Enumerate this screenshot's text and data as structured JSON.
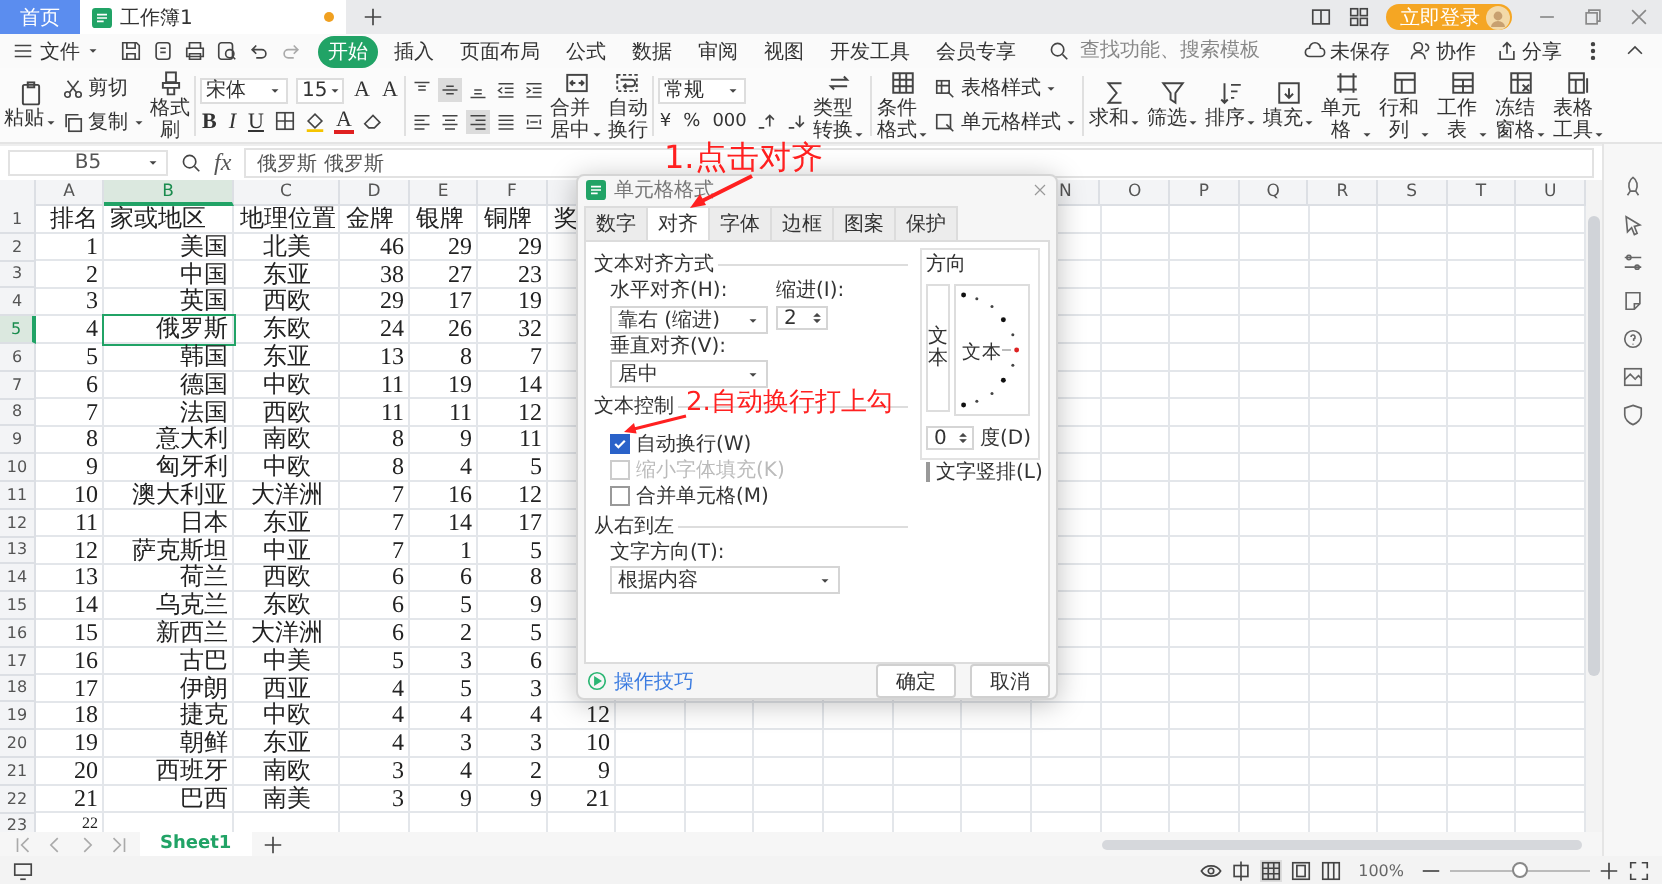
{
  "title_bar": {
    "tabs": [
      {
        "kind": "home",
        "label": "首页",
        "selected": false
      },
      {
        "kind": "doc",
        "label": "工作簿1",
        "selected": true,
        "modified": true
      }
    ],
    "login": "立即登录"
  },
  "menu_bar": {
    "file": "文件",
    "tabs": [
      {
        "label": "开始",
        "selected": true
      },
      {
        "label": "插入",
        "selected": false
      },
      {
        "label": "页面布局",
        "selected": false
      },
      {
        "label": "公式",
        "selected": false
      },
      {
        "label": "数据",
        "selected": false
      },
      {
        "label": "审阅",
        "selected": false
      },
      {
        "label": "视图",
        "selected": false
      },
      {
        "label": "开发工具",
        "selected": false
      },
      {
        "label": "会员专享",
        "selected": false
      }
    ],
    "search": {
      "placeholder": "查找功能、搜索模板"
    },
    "actions": [
      "未保存",
      "协作",
      "分享"
    ]
  },
  "ribbon": {
    "paste": "粘贴",
    "cut": "剪切",
    "copy": "复制",
    "format_painter": "格式刷",
    "font_name": "宋体",
    "font_size": "15",
    "size_buttons": [
      "A",
      "A"
    ],
    "style_buttons": [
      "B",
      "I",
      "U"
    ],
    "font_color": "A",
    "alignment": [
      {
        "selected": false
      },
      {
        "selected": true
      },
      {
        "selected": false
      },
      {
        "selected": false
      },
      {
        "selected": false
      },
      {
        "selected": false
      },
      {
        "selected": false
      },
      {
        "selected": true
      },
      {
        "selected": false
      },
      {
        "selected": false
      }
    ],
    "merge": "合并居中",
    "wrap": "自动换行",
    "number_format": "常规",
    "number_buttons": [
      "¥",
      "%",
      "000"
    ],
    "convert": "类型转换",
    "conditional": "条件格式",
    "styles": [
      "表格样式",
      "单元格样式"
    ],
    "tools": [
      "求和",
      "筛选",
      "排序",
      "填充",
      "单元格",
      "行和列",
      "工作表",
      "冻结窗格",
      "表格工具"
    ]
  },
  "formula_bar": {
    "cell": "B5",
    "fx": "fx",
    "value": "俄罗斯 俄罗斯"
  },
  "sheet": {
    "columns": [
      {
        "label": "A",
        "selected": false
      },
      {
        "label": "B",
        "selected": true
      },
      {
        "label": "C",
        "selected": false
      },
      {
        "label": "D",
        "selected": false
      },
      {
        "label": "E",
        "selected": false
      },
      {
        "label": "F",
        "selected": false
      },
      {
        "label": "N",
        "selected": false
      },
      {
        "label": "O",
        "selected": false
      },
      {
        "label": "P",
        "selected": false
      },
      {
        "label": "Q",
        "selected": false
      },
      {
        "label": "R",
        "selected": false
      },
      {
        "label": "S",
        "selected": false
      },
      {
        "label": "T",
        "selected": false
      },
      {
        "label": "U",
        "selected": false
      }
    ],
    "rows": [
      {
        "number": "1",
        "selected": false,
        "cells": [
          "排名",
          "家或地区",
          "地理位置",
          "金牌",
          "银牌",
          "铜牌",
          "奖"
        ]
      },
      {
        "number": "2",
        "selected": false,
        "cells": [
          "1",
          "美国",
          "北美",
          "46",
          "29",
          "29"
        ]
      },
      {
        "number": "3",
        "selected": false,
        "cells": [
          "2",
          "中国",
          "东亚",
          "38",
          "27",
          "23"
        ]
      },
      {
        "number": "4",
        "selected": false,
        "cells": [
          "3",
          "英国",
          "西欧",
          "29",
          "17",
          "19"
        ]
      },
      {
        "number": "5",
        "selected": true,
        "cells": [
          "4",
          "俄罗斯",
          "东欧",
          "24",
          "26",
          "32"
        ]
      },
      {
        "number": "6",
        "selected": false,
        "cells": [
          "5",
          "韩国",
          "东亚",
          "13",
          "8",
          "7"
        ]
      },
      {
        "number": "7",
        "selected": false,
        "cells": [
          "6",
          "德国",
          "中欧",
          "11",
          "19",
          "14"
        ]
      },
      {
        "number": "8",
        "selected": false,
        "cells": [
          "7",
          "法国",
          "西欧",
          "11",
          "11",
          "12"
        ]
      },
      {
        "number": "9",
        "selected": false,
        "cells": [
          "8",
          "意大利",
          "南欧",
          "8",
          "9",
          "11"
        ]
      },
      {
        "number": "10",
        "selected": false,
        "cells": [
          "9",
          "匈牙利",
          "中欧",
          "8",
          "4",
          "5"
        ]
      },
      {
        "number": "11",
        "selected": false,
        "cells": [
          "10",
          "澳大利亚",
          "大洋洲",
          "7",
          "16",
          "12"
        ]
      },
      {
        "number": "12",
        "selected": false,
        "cells": [
          "11",
          "日本",
          "东亚",
          "7",
          "14",
          "17"
        ]
      },
      {
        "number": "13",
        "selected": false,
        "cells": [
          "12",
          "萨克斯坦",
          "中亚",
          "7",
          "1",
          "5"
        ]
      },
      {
        "number": "14",
        "selected": false,
        "cells": [
          "13",
          "荷兰",
          "西欧",
          "6",
          "6",
          "8"
        ]
      },
      {
        "number": "15",
        "selected": false,
        "cells": [
          "14",
          "乌克兰",
          "东欧",
          "6",
          "5",
          "9"
        ]
      },
      {
        "number": "16",
        "selected": false,
        "cells": [
          "15",
          "新西兰",
          "大洋洲",
          "6",
          "2",
          "5"
        ]
      },
      {
        "number": "17",
        "selected": false,
        "cells": [
          "16",
          "古巴",
          "中美",
          "5",
          "3",
          "6"
        ]
      },
      {
        "number": "18",
        "selected": false,
        "cells": [
          "17",
          "伊朗",
          "西亚",
          "4",
          "5",
          "3"
        ]
      },
      {
        "number": "19",
        "selected": false,
        "cells": [
          "18",
          "捷克",
          "中欧",
          "4",
          "4",
          "4",
          "12"
        ]
      },
      {
        "number": "20",
        "selected": false,
        "cells": [
          "19",
          "朝鲜",
          "东亚",
          "4",
          "3",
          "3",
          "10"
        ]
      },
      {
        "number": "21",
        "selected": false,
        "cells": [
          "20",
          "西班牙",
          "南欧",
          "3",
          "4",
          "2",
          "9"
        ]
      },
      {
        "number": "22",
        "selected": false,
        "cells": [
          "21",
          "巴西",
          "南美",
          "3",
          "9",
          "9",
          "21"
        ]
      },
      {
        "number": "23",
        "selected": false,
        "cells": [
          "22"
        ]
      }
    ]
  },
  "sheet_tabs": [
    {
      "label": "Sheet1",
      "selected": true
    }
  ],
  "status_bar": {
    "zoom": "100%",
    "zoom_slider": {
      "level": 0.5
    }
  },
  "dialog": {
    "title": "单元格格式",
    "tabs": [
      {
        "label": "数字",
        "selected": false
      },
      {
        "label": "对齐",
        "selected": true
      },
      {
        "label": "字体",
        "selected": false
      },
      {
        "label": "边框",
        "selected": false
      },
      {
        "label": "图案",
        "selected": false
      },
      {
        "label": "保护",
        "selected": false
      }
    ],
    "alignment_section": "文本对齐方式",
    "horizontal": {
      "label": "水平对齐(H):",
      "value": "靠右 (缩进)"
    },
    "indent": {
      "label": "缩进(I):",
      "value": "2"
    },
    "vertical": {
      "label": "垂直对齐(V):",
      "value": "居中"
    },
    "control_section": "文本控制",
    "options": [
      {
        "label": "自动换行(W)",
        "checked": true,
        "disabled": false
      },
      {
        "label": "缩小字体填充(K)",
        "checked": false,
        "disabled": true
      },
      {
        "label": "合并单元格(M)",
        "checked": false,
        "disabled": false
      }
    ],
    "rtl_section": "从右到左",
    "direction": {
      "label": "文字方向(T):",
      "value": "根据内容"
    },
    "orientation": {
      "title": "方向",
      "vertical_text": "文本",
      "dial_text": "文本",
      "degrees": "0",
      "degrees_label": "度(D)",
      "stacked": {
        "label": "文字竖排(L)",
        "checked": false
      }
    },
    "tips": "操作技巧",
    "buttons": [
      "确定",
      "取消"
    ]
  },
  "annotations": [
    {
      "text": "1.点击对齐"
    },
    {
      "text": "2.自动换行打上勾"
    }
  ]
}
